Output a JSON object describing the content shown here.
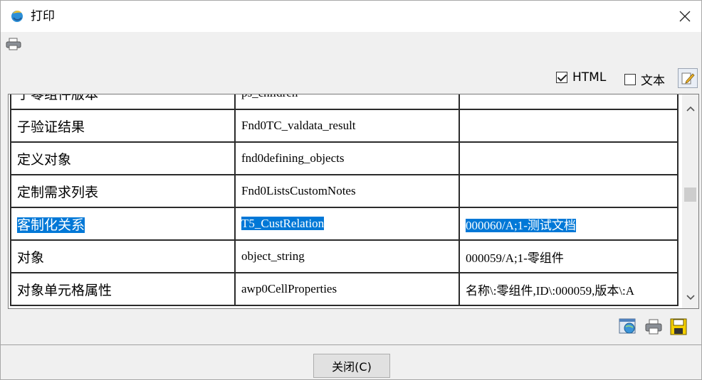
{
  "window": {
    "title": "打印"
  },
  "toolbar": {
    "print_icon": "printer-icon"
  },
  "options": {
    "html_label": "HTML",
    "html_checked": true,
    "text_label": "文本",
    "text_checked": false,
    "edit_icon": "edit-icon"
  },
  "table": {
    "rows": [
      {
        "name": "子零组件版本",
        "key": "ps_children",
        "value": ""
      },
      {
        "name": "子验证结果",
        "key": "Fnd0TC_valdata_result",
        "value": ""
      },
      {
        "name": "定义对象",
        "key": "fnd0defining_objects",
        "value": ""
      },
      {
        "name": "定制需求列表",
        "key": "Fnd0ListsCustomNotes",
        "value": ""
      },
      {
        "name": "客制化关系",
        "key": "T5_CustRelation",
        "value": "000060/A;1-测试文档",
        "selected": true
      },
      {
        "name": "对象",
        "key": "object_string",
        "value": "000059/A;1-零组件"
      },
      {
        "name": "对象单元格属性",
        "key": "awp0CellProperties",
        "value": "名称\\:零组件,ID\\:000059,版本\\:A"
      }
    ]
  },
  "bottom_icons": [
    "browser-preview-icon",
    "printer-icon",
    "save-icon"
  ],
  "footer": {
    "close_label": "关闭(C)"
  }
}
